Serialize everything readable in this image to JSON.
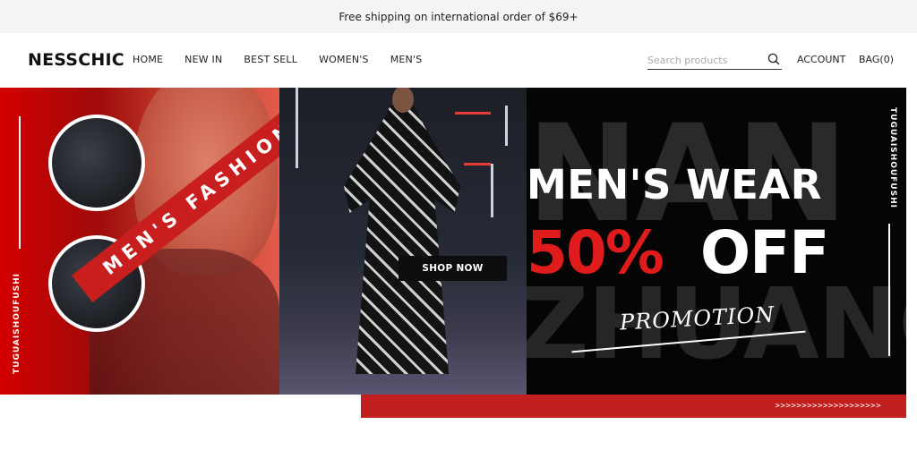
{
  "announcement": "Free shipping on international order of $69+",
  "header": {
    "logo": "NESSCHIC",
    "nav": [
      "HOME",
      "NEW IN",
      "BEST SELL",
      "WOMEN'S",
      "MEN'S"
    ],
    "search_placeholder": "Search products",
    "search_icon": "search-icon",
    "account": "ACCOUNT",
    "bag": "BAG(0)"
  },
  "hero": {
    "ribbon_text": "MEN'S FASHION",
    "side_text_left": "TUGUAISHOUFUSHI",
    "side_text_right": "TUGUAISHOUFUSHI",
    "shop_now": "SHOP NOW",
    "headline": "MEN'S WEAR",
    "discount": "50%",
    "off": "OFF",
    "promo": "PROMOTION",
    "bg_text_1": "NAN",
    "bg_text_2": "ZHUANG",
    "bar_arrows": ">>>>>>>>>>>>>>>>>>>>",
    "colors": {
      "accent_red": "#c81e1e",
      "discount_red": "#e01b1b",
      "panel_black": "#050505"
    }
  }
}
